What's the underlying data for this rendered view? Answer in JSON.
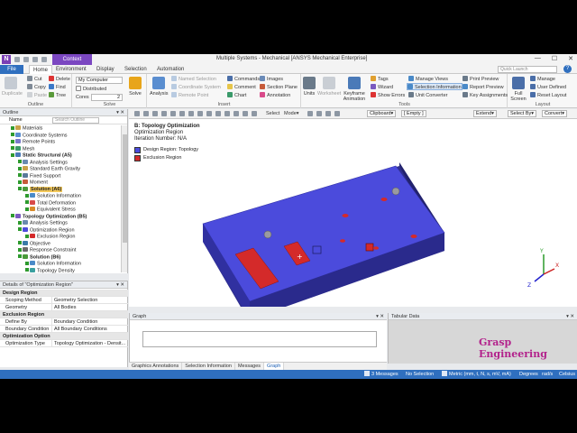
{
  "app": {
    "window_title": "Multiple Systems - Mechanical [ANSYS Mechanical Enterprise]",
    "context_tab": "Context",
    "logo_letter": "N",
    "search_placeholder": "Quick Launch",
    "help": "?",
    "window_controls": [
      "—",
      "☐",
      "✕"
    ]
  },
  "ribbon_tabs": [
    "File",
    "Home",
    "Environment",
    "Display",
    "Selection",
    "Automation"
  ],
  "ribbon": {
    "outline": {
      "label": "Outline",
      "duplicate": "Duplicate",
      "cut": "Cut",
      "copy": "Copy",
      "paste": "Paste",
      "delete": "Delete",
      "find": "Find",
      "tree": "Tree"
    },
    "solve": {
      "label": "Solve",
      "computer": "My Computer",
      "distributed": "Distributed",
      "cores_label": "Cores",
      "cores_value": "2",
      "solve_button": "Solve"
    },
    "insert": {
      "label": "Insert",
      "analysis": "Analysis",
      "named_selection": "Named Selection",
      "coordinate_system": "Coordinate System",
      "remote_point": "Remote Point",
      "commands": "Commands",
      "comment": "Comment",
      "chart": "Chart",
      "images": "Images",
      "section_plane": "Section Plane",
      "annotation": "Annotation"
    },
    "tools": {
      "label": "Tools",
      "units": "Units",
      "worksheet": "Worksheet",
      "keyframe_animation": "Keyframe Animation",
      "tags": "Tags",
      "wizard": "Wizard",
      "show_errors": "Show Errors",
      "manage_views": "Manage Views",
      "selection_information": "Selection Information",
      "unit_converter": "Unit Converter",
      "print_preview": "Print Preview",
      "report_preview": "Report Preview",
      "key_assignments": "Key Assignments"
    },
    "layout": {
      "label": "Layout",
      "full_screen": "Full Screen",
      "manage": "Manage",
      "user_defined": "User Defined",
      "reset_layout": "Reset Layout"
    }
  },
  "outline": {
    "title": "Outline",
    "name_label": "Name",
    "search_placeholder": "Search Outline",
    "tree": [
      {
        "label": "Materials",
        "indent": 1,
        "icon": "folder-icon"
      },
      {
        "label": "Coordinate Systems",
        "indent": 1,
        "icon": "axes-icon"
      },
      {
        "label": "Remote Points",
        "indent": 1,
        "icon": "point-icon"
      },
      {
        "label": "Mesh",
        "indent": 1,
        "icon": "mesh-icon"
      },
      {
        "label": "Static Structural (A5)",
        "indent": 1,
        "icon": "static-icon",
        "bold": true
      },
      {
        "label": "Analysis Settings",
        "indent": 2,
        "icon": "settings-icon"
      },
      {
        "label": "Standard Earth Gravity",
        "indent": 2,
        "icon": "gravity-icon"
      },
      {
        "label": "Fixed Support",
        "indent": 2,
        "icon": "support-icon"
      },
      {
        "label": "Moment",
        "indent": 2,
        "icon": "moment-icon"
      },
      {
        "label": "Solution (A6)",
        "indent": 2,
        "icon": "solution-icon",
        "selected": true,
        "bold": true
      },
      {
        "label": "Solution Information",
        "indent": 3,
        "icon": "info-icon"
      },
      {
        "label": "Total Deformation",
        "indent": 3,
        "icon": "deformation-icon"
      },
      {
        "label": "Equivalent Stress",
        "indent": 3,
        "icon": "stress-icon"
      },
      {
        "label": "Topology Optimization (B5)",
        "indent": 1,
        "icon": "topology-icon",
        "bold": true
      },
      {
        "label": "Analysis Settings",
        "indent": 2,
        "icon": "settings-icon"
      },
      {
        "label": "Optimization Region",
        "indent": 2,
        "icon": "region-icon"
      },
      {
        "label": "Exclusion Region",
        "indent": 3,
        "icon": "exclusion-icon"
      },
      {
        "label": "Objective",
        "indent": 2,
        "icon": "objective-icon"
      },
      {
        "label": "Response Constraint",
        "indent": 2,
        "icon": "constraint-icon"
      },
      {
        "label": "Solution (B6)",
        "indent": 2,
        "icon": "solution-icon",
        "bold": true
      },
      {
        "label": "Solution Information",
        "indent": 3,
        "icon": "info-icon"
      },
      {
        "label": "Topology Density",
        "indent": 3,
        "icon": "density-icon"
      }
    ]
  },
  "details": {
    "title": "Details of \"Optimization Region\"",
    "sections": [
      {
        "name": "Design Region",
        "rows": [
          [
            "Scoping Method",
            "Geometry Selection"
          ],
          [
            "Geometry",
            "All Bodies"
          ]
        ]
      },
      {
        "name": "Exclusion Region",
        "rows": [
          [
            "Define By",
            "Boundary Condition"
          ],
          [
            "Boundary Condition",
            "All Boundary Conditions"
          ]
        ]
      },
      {
        "name": "Optimization Option",
        "rows": [
          [
            "Optimization Type",
            "Topology Optimization - Densit..."
          ]
        ]
      }
    ]
  },
  "graphics_toolbar": {
    "select": "Select",
    "mode": "Mode",
    "clipboard": "Clipboard",
    "empty": "[ Empty ]",
    "extend": "Extend",
    "select_by": "Select By",
    "convert": "Convert"
  },
  "viewport": {
    "title": "B: Topology Optimization",
    "subtitle": "Optimization Region",
    "iteration": "Iteration Number: N/A",
    "legend": [
      {
        "label": "Design Region: Topology",
        "color": "#4b4bdc"
      },
      {
        "label": "Exclusion Region",
        "color": "#d42a2a"
      }
    ],
    "triad": {
      "x": "X",
      "y": "Y",
      "z": "Z"
    }
  },
  "graph": {
    "title": "Graph"
  },
  "tabular": {
    "title": "Tabular Data",
    "watermark": "Grasp Engineering"
  },
  "bottom_tabs": [
    "Graphics Annotations",
    "Selection Information",
    "Messages",
    "Graph"
  ],
  "status": {
    "messages": "3 Messages",
    "selection": "No Selection",
    "units": "Metric (mm, t, N, s, mV, mA)",
    "angle": "Degrees",
    "rate": "rad/s",
    "temp": "Celsius"
  }
}
